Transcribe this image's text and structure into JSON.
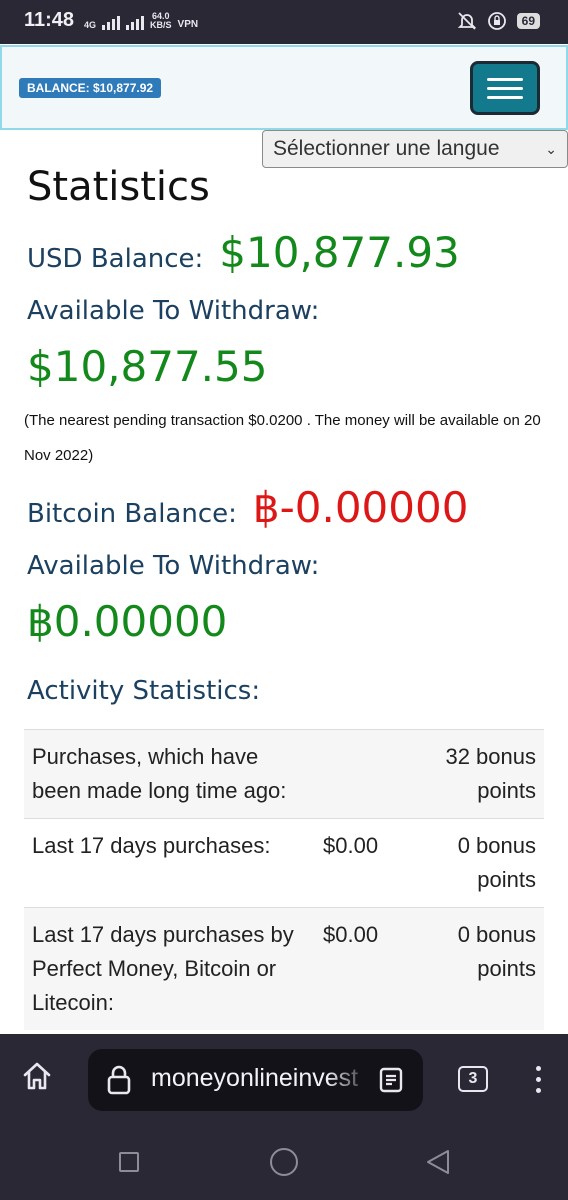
{
  "status_bar": {
    "time": "11:48",
    "network": "4G",
    "speed_value": "64.0",
    "speed_unit": "KB/S",
    "vpn": "VPN",
    "battery": "69"
  },
  "header": {
    "balance_badge": "BALANCE: $10,877.92"
  },
  "language_select": {
    "selected": "Sélectionner une langue"
  },
  "statistics": {
    "title": "Statistics",
    "usd_label": "USD Balance:",
    "usd_value": "$10,877.93",
    "usd_withdraw_label": "Available To Withdraw:",
    "usd_withdraw_value": "$10,877.55",
    "pending_note": "(The nearest pending transaction  $0.0200 . The money will be available on 20 Nov 2022)",
    "btc_label": "Bitcoin Balance:",
    "btc_value": "฿-0.00000",
    "btc_withdraw_label": "Available To Withdraw:",
    "btc_withdraw_value": "฿0.00000",
    "activity_title": "Activity Statistics:"
  },
  "activity_rows": [
    {
      "label": "Purchases, which have been made long time ago:",
      "amount": "",
      "points": "32 bonus points"
    },
    {
      "label": "Last 17 days purchases:",
      "amount": "$0.00",
      "points": "0 bonus points"
    },
    {
      "label": "Last 17 days purchases by Perfect Money, Bitcoin or Litecoin:",
      "amount": "$0.00",
      "points": "0 bonus points"
    }
  ],
  "browser": {
    "url": "moneyonlineinvest",
    "tab_count": "3"
  },
  "colors": {
    "positive": "#14891b",
    "negative": "#dd1616",
    "heading": "#1b4060",
    "badge": "#2f7ab9",
    "menu_button": "#137a8e"
  }
}
